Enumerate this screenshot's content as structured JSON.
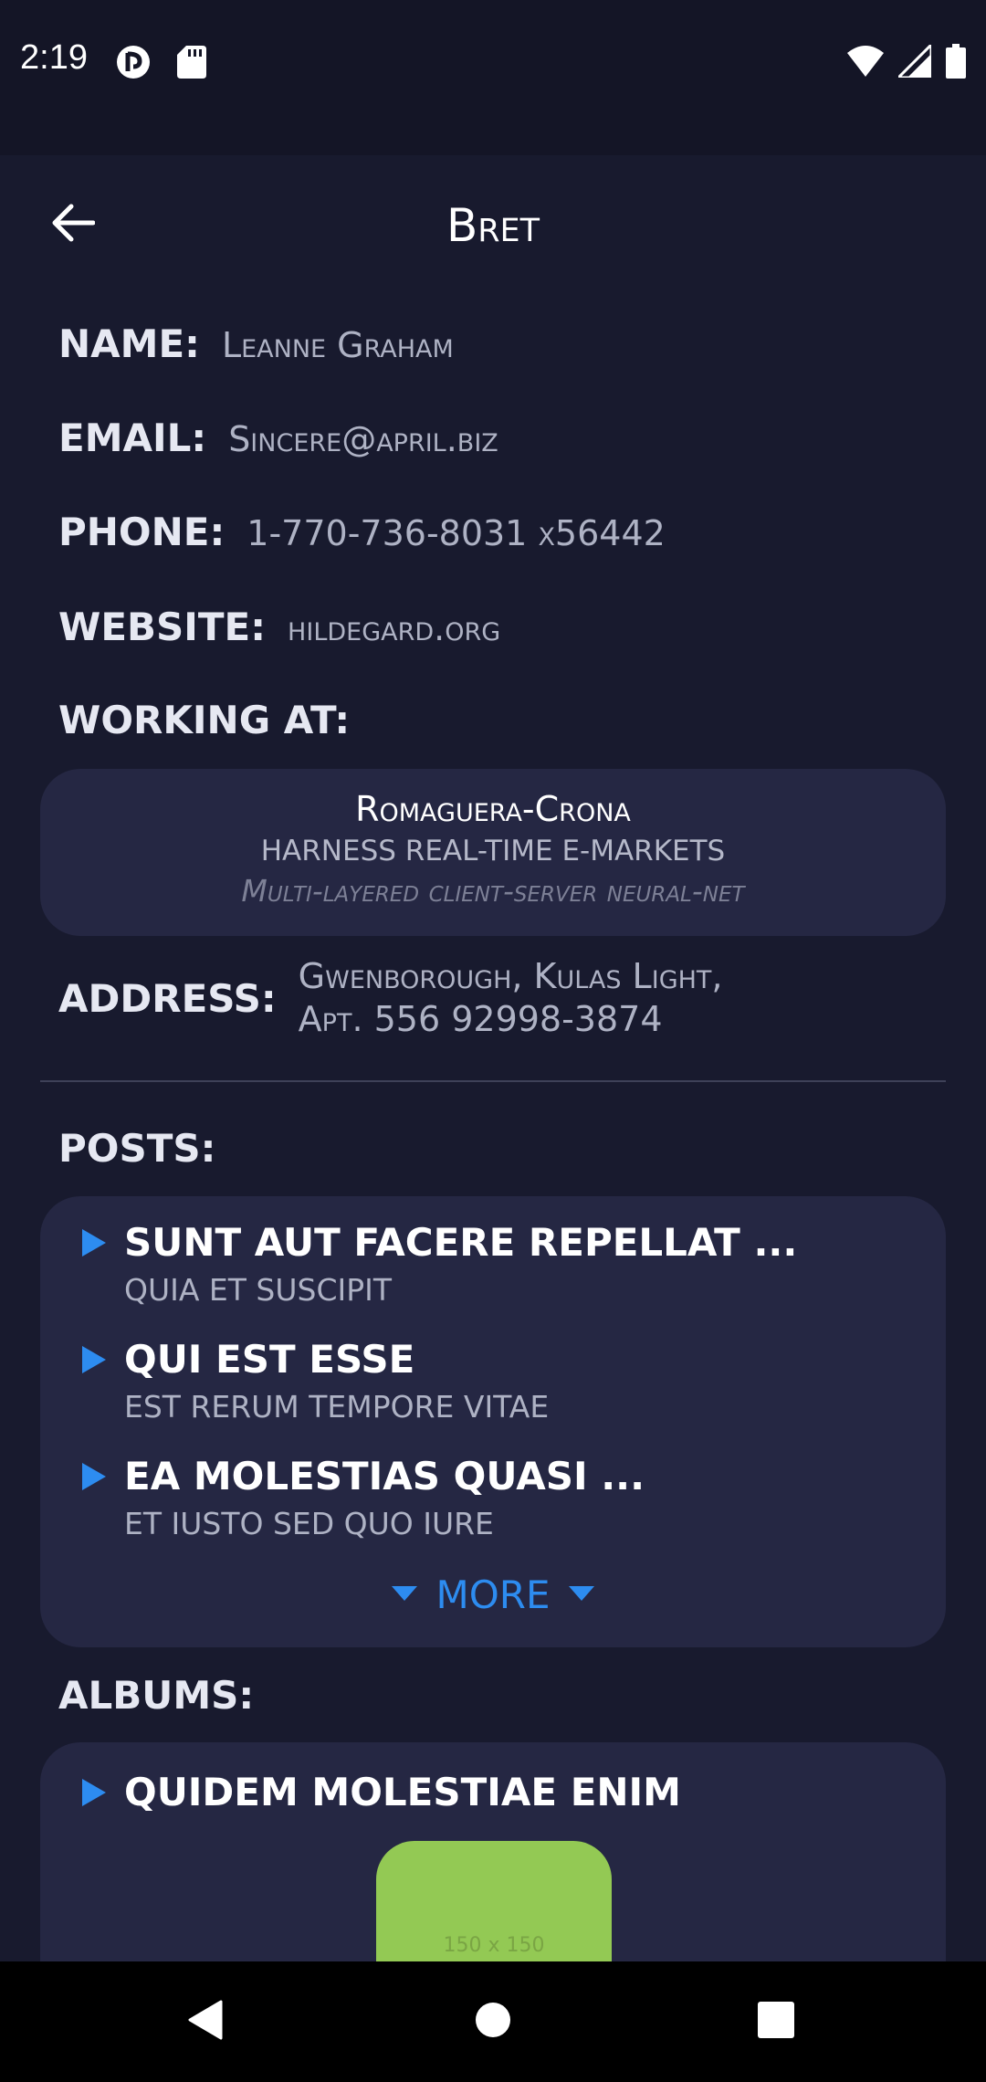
{
  "status_bar": {
    "time": "2:19",
    "left_icons": [
      "privacy-indicator-icon",
      "sd-card-icon"
    ],
    "right_icons": [
      "wifi-icon",
      "cellular-signal-icon",
      "battery-icon"
    ]
  },
  "app_bar": {
    "title": "Bret",
    "back_icon": "arrow-left-icon"
  },
  "profile": {
    "name_label": "NAME:",
    "name_value": "Leanne Graham",
    "email_label": "EMAIL:",
    "email_value": "Sincere@april.biz",
    "phone_label": "PHONE:",
    "phone_value": "1-770-736-8031 x56442",
    "website_label": "WEBSITE:",
    "website_value": "hildegard.org",
    "working_label": "WORKING AT:",
    "company": {
      "name": "Romaguera-Crona",
      "catch_phrase": "harness real-time e-markets",
      "bs": "Multi-layered client-server neural-net"
    },
    "address_label": "ADDRESS:",
    "address_line1": "Gwenborough, Kulas Light,",
    "address_line2": "Apt. 556 92998-3874"
  },
  "posts": {
    "label": "POSTS:",
    "items": [
      {
        "title": "sunt aut facere repellat ...",
        "body": "quia et suscipit"
      },
      {
        "title": "qui est esse",
        "body": "est rerum tempore vitae"
      },
      {
        "title": "ea molestias quasi ...",
        "body": "et iusto sed quo iure"
      }
    ],
    "more_label": "MORE"
  },
  "albums": {
    "label": "ALBUMS:",
    "items": [
      {
        "title": "quidem molestiae enim",
        "thumb_text": "150 x 150"
      }
    ]
  },
  "colors": {
    "background": "#181a2e",
    "card": "#252743",
    "accent": "#2d8cf0",
    "thumb": "#93c954"
  },
  "nav_bar": {
    "icons": [
      "back-triangle-icon",
      "home-circle-icon",
      "recents-square-icon"
    ]
  }
}
